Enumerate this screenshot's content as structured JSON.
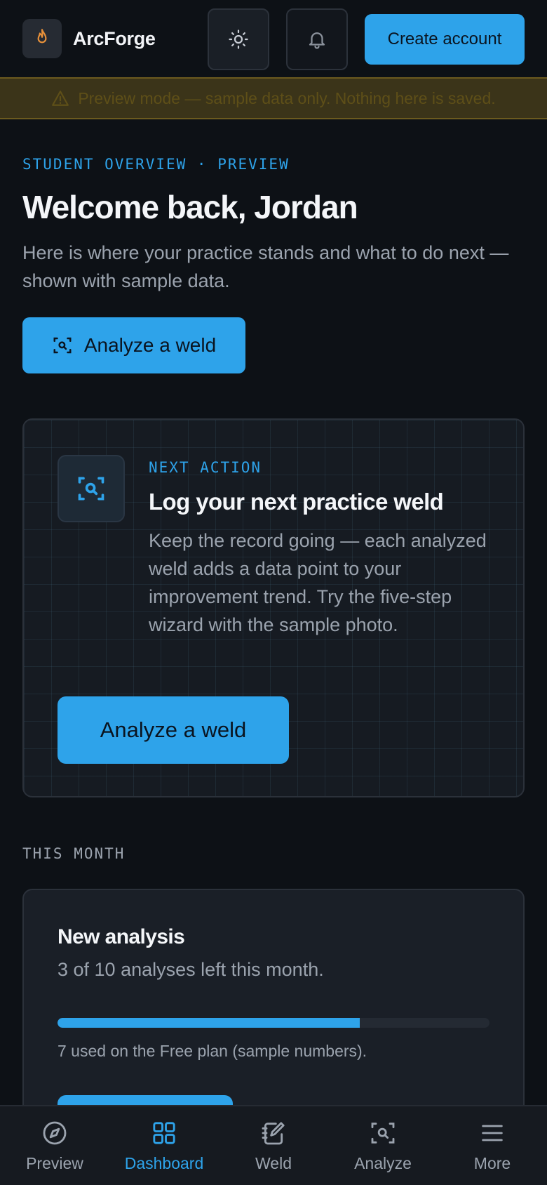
{
  "header": {
    "brand": "ArcForge",
    "create_account_label": "Create account"
  },
  "banner": {
    "text": "Preview mode — sample data only. Nothing here is saved."
  },
  "intro": {
    "eyebrow": "STUDENT OVERVIEW · PREVIEW",
    "title": "Welcome back, Jordan",
    "subtitle": "Here is where your practice stands and what to do next — shown with sample data.",
    "primary_button": "Analyze a weld"
  },
  "next_action": {
    "eyebrow": "NEXT ACTION",
    "title": "Log your next practice weld",
    "body": "Keep the record going — each analyzed weld adds a data point to your improvement trend. Try the five-step wizard with the sample photo.",
    "button": "Analyze a weld"
  },
  "this_month": {
    "section_label": "THIS MONTH",
    "card_title": "New analysis",
    "card_subtitle": "3 of 10 analyses left this month.",
    "usage_fraction": 0.7,
    "note": "7 used on the Free plan (sample numbers)."
  },
  "bottom_nav": {
    "items": [
      {
        "label": "Preview",
        "icon": "compass-icon"
      },
      {
        "label": "Dashboard",
        "icon": "grid-icon",
        "active": true
      },
      {
        "label": "Weld",
        "icon": "notebook-edit-icon"
      },
      {
        "label": "Analyze",
        "icon": "scan-search-icon"
      },
      {
        "label": "More",
        "icon": "menu-icon"
      }
    ]
  },
  "colors": {
    "accent": "#2ea3ea",
    "background": "#0d1116",
    "banner_bg": "#3b3419",
    "flame": "#e8913a"
  }
}
